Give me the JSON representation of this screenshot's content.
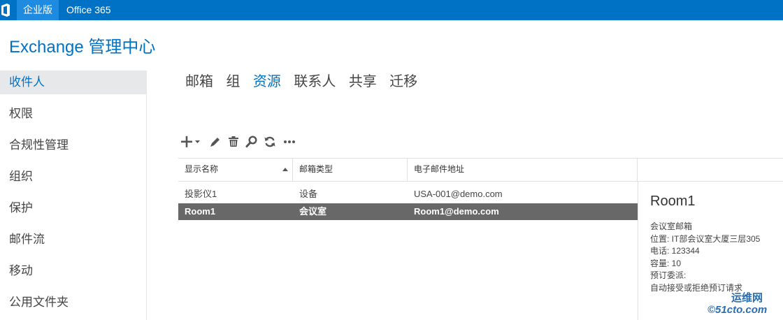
{
  "topbar": {
    "tabs": [
      {
        "label": "企业版",
        "active": true
      },
      {
        "label": "Office 365",
        "active": false
      }
    ]
  },
  "app": {
    "title": "Exchange 管理中心"
  },
  "sidebar": {
    "items": [
      {
        "label": "收件人",
        "active": true
      },
      {
        "label": "权限",
        "active": false
      },
      {
        "label": "合规性管理",
        "active": false
      },
      {
        "label": "组织",
        "active": false
      },
      {
        "label": "保护",
        "active": false
      },
      {
        "label": "邮件流",
        "active": false
      },
      {
        "label": "移动",
        "active": false
      },
      {
        "label": "公用文件夹",
        "active": false
      }
    ]
  },
  "subtabs": [
    {
      "label": "邮箱",
      "active": false
    },
    {
      "label": "组",
      "active": false
    },
    {
      "label": "资源",
      "active": true
    },
    {
      "label": "联系人",
      "active": false
    },
    {
      "label": "共享",
      "active": false
    },
    {
      "label": "迁移",
      "active": false
    }
  ],
  "toolbar": {
    "icons": [
      "add-icon",
      "edit-icon",
      "delete-icon",
      "search-icon",
      "refresh-icon",
      "more-icon"
    ]
  },
  "table": {
    "columns": [
      "显示名称",
      "邮箱类型",
      "电子邮件地址"
    ],
    "rows": [
      {
        "name": "投影仪1",
        "type": "设备",
        "email": "USA-001@demo.com",
        "selected": false
      },
      {
        "name": "Room1",
        "type": "会议室",
        "email": "Room1@demo.com",
        "selected": true
      }
    ]
  },
  "details": {
    "title": "Room1",
    "lines": [
      "会议室邮箱",
      "位置: IT部会议室大厦三层305",
      "电话: 123344",
      "容量: 10",
      "预订委派:",
      "自动接受或拒绝预订请求"
    ]
  },
  "watermark": {
    "top": "运维网",
    "bottom": "©51cto.com"
  },
  "colors": {
    "accent": "#0072c6",
    "selected_row": "#686868",
    "sidebar_active": "#e7e8ea"
  }
}
